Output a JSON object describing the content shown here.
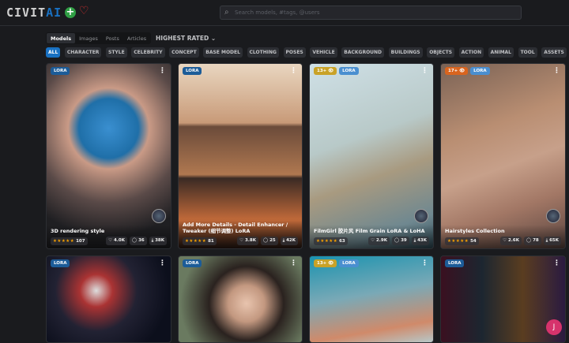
{
  "header": {
    "logo_a": "CIVIT",
    "logo_b": "AI",
    "search_placeholder": "Search models, #tags, @users"
  },
  "tabs": [
    "Models",
    "Images",
    "Posts",
    "Articles"
  ],
  "sort": "HIGHEST RATED ⌄",
  "chips": [
    "ALL",
    "CHARACTER",
    "STYLE",
    "CELEBRITY",
    "CONCEPT",
    "BASE MODEL",
    "CLOTHING",
    "POSES",
    "VEHICLE",
    "BACKGROUND",
    "BUILDINGS",
    "OBJECTS",
    "ACTION",
    "ANIMAL",
    "TOOL",
    "ASSETS"
  ],
  "cards": [
    {
      "badges": [
        "LORA"
      ],
      "title": "3D rendering style",
      "rating": "107",
      "likes": "4.0K",
      "comments": "36",
      "downloads": "38K"
    },
    {
      "badges": [
        "LORA"
      ],
      "title": "Add More Details - Detail Enhancer / Tweaker (细节调整) LoRA",
      "rating": "81",
      "likes": "3.8K",
      "comments": "25",
      "downloads": "42K"
    },
    {
      "badges": [
        "13+ 👁",
        "LORA"
      ],
      "title": "FilmGirl 胶片风 Film Grain LoRA & LoHA",
      "rating": "63",
      "likes": "2.9K",
      "comments": "39",
      "downloads": "43K"
    },
    {
      "badges": [
        "17+ 👁",
        "LORA"
      ],
      "title": "Hairstyles Collection",
      "rating": "54",
      "likes": "2.6K",
      "comments": "78",
      "downloads": "65K"
    },
    {
      "badges": [
        "LORA"
      ]
    },
    {
      "badges": [
        "LORA"
      ]
    },
    {
      "badges": [
        "13+ 👁",
        "LORA"
      ]
    },
    {
      "badges": [
        "LORA"
      ]
    }
  ],
  "stars": "★★★★★",
  "fab_label": "J"
}
